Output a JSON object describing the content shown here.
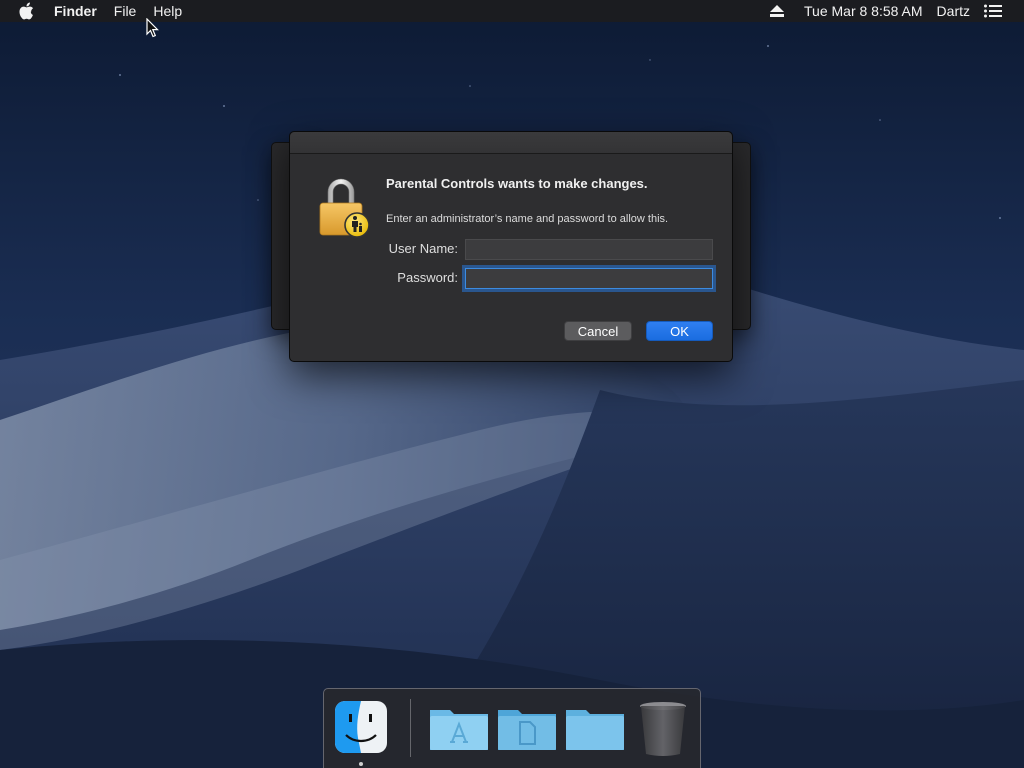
{
  "menubar": {
    "app_name": "Finder",
    "menus": [
      "File",
      "Help"
    ],
    "datetime": "Tue Mar 8  8:58 AM",
    "user": "Dartz"
  },
  "dialog": {
    "heading": "Parental Controls wants to make changes.",
    "message": "Enter an administrator’s name and password to allow this.",
    "username_label": "User Name:",
    "username_value": "",
    "password_label": "Password:",
    "password_value": "",
    "cancel_label": "Cancel",
    "ok_label": "OK"
  },
  "dock": {
    "items": [
      {
        "name": "Finder",
        "icon": "finder-icon",
        "running": true
      },
      {
        "name": "Applications",
        "icon": "applications-folder-icon"
      },
      {
        "name": "Documents",
        "icon": "documents-folder-icon"
      },
      {
        "name": "Downloads",
        "icon": "folder-icon"
      },
      {
        "name": "Trash",
        "icon": "trash-icon"
      }
    ]
  },
  "colors": {
    "accent": "#1a6de0",
    "dialog_bg": "#2e2e30",
    "menubar_bg": "#1c1c1e"
  }
}
